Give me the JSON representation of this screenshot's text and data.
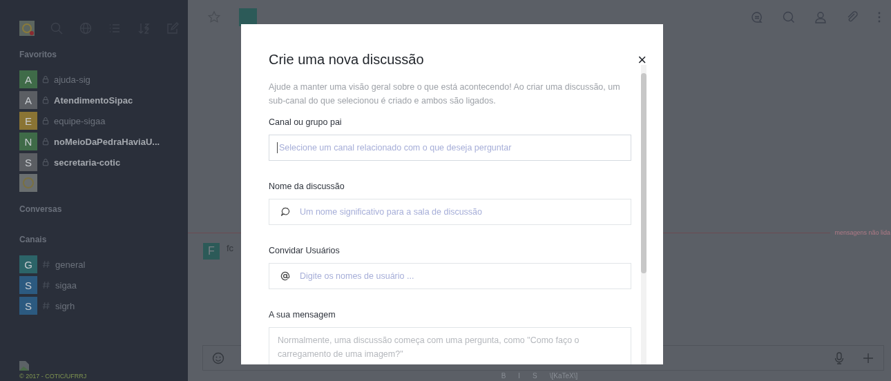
{
  "sidebar": {
    "sections": [
      {
        "title": "Favoritos",
        "items": [
          {
            "letter": "A",
            "color": "#3f6b48",
            "kind": "private",
            "name": "ajuda-sig",
            "unread": false
          },
          {
            "letter": "A",
            "color": "#5b5e63",
            "kind": "private",
            "name": "AtendimentoSipac",
            "unread": true
          },
          {
            "letter": "E",
            "color": "#8a7434",
            "kind": "private",
            "name": "equipe-sigaa",
            "unread": false
          },
          {
            "letter": "N",
            "color": "#3f6b48",
            "kind": "private",
            "name": "noMeioDaPedraHaviaU...",
            "unread": true
          },
          {
            "letter": "S",
            "color": "#5b5e63",
            "kind": "private",
            "name": "secretaria-cotic",
            "unread": true
          },
          {
            "color": "#6a6f70",
            "kind": "logo"
          }
        ]
      },
      {
        "title": "Conversas"
      },
      {
        "title": "Canais",
        "items": [
          {
            "letter": "G",
            "color": "#2c6468",
            "kind": "public",
            "name": "general",
            "unread": false
          },
          {
            "letter": "S",
            "color": "#2c5a80",
            "kind": "public",
            "name": "sigaa",
            "unread": false
          },
          {
            "letter": "S",
            "color": "#2c5a80",
            "kind": "public",
            "name": "sigrh",
            "unread": false
          }
        ]
      }
    ],
    "footer": "© 2017 - COTIC/UFRRJ"
  },
  "room": {
    "message": {
      "letter": "F",
      "author": "fc"
    },
    "unread_divider": "mensagens não lida",
    "format_bar": [
      "B",
      "I",
      "S",
      "\\[KaTeX\\]"
    ]
  },
  "modal": {
    "title": "Crie uma nova discussão",
    "close": "×",
    "description": "Ajude a manter uma visão geral sobre o que está acontecendo! Ao criar uma discussão, um sub-canal do que selecionou é criado e ambos são ligados.",
    "fields": [
      {
        "label": "Canal ou grupo pai",
        "kind": "plain",
        "placeholder": "Selecione um canal relacionado com o que deseja perguntar",
        "focused": true
      },
      {
        "label": "Nome da discussão",
        "kind": "discussion",
        "placeholder": "Um nome significativo para a sala de discussão",
        "focused": false
      },
      {
        "label": "Convidar Usuários",
        "kind": "mention",
        "placeholder": "Digite os nomes de usuário ...",
        "focused": false
      },
      {
        "label": "A sua mensagem",
        "kind": "textarea",
        "placeholder": "Normalmente, uma discussão começa com uma pergunta, como \"Como faço o carregamento de uma imagem?\"",
        "focused": false
      }
    ]
  }
}
